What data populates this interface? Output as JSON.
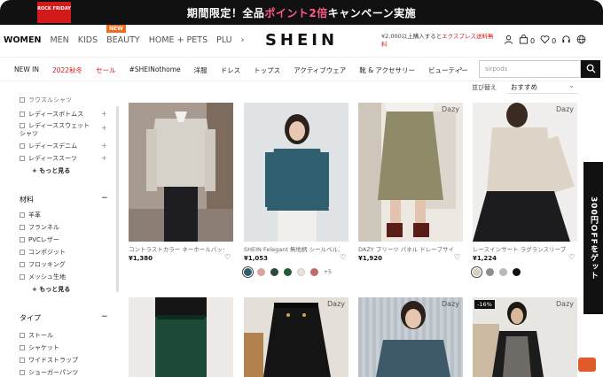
{
  "promo": {
    "logo_text": "ROCK FRIDAY",
    "text_before": "期間限定！全品",
    "text_highlight": "ポイント2倍",
    "text_after": "キャンペーン実施"
  },
  "header": {
    "gender_nav": [
      "WOMEN",
      "MEN",
      "KIDS",
      "BEAUTY",
      "HOME + PETS",
      "PLU",
      "›"
    ],
    "new_badge": "NEW",
    "logo": "SHEIN",
    "ship_note_before": "¥2,000以上購入すると",
    "ship_note_highlight": "エクスプレス送料無料",
    "cart_count": "0",
    "wishlist_count": "0"
  },
  "categories": [
    "NEW IN",
    "2022秋冬",
    "セール",
    "#SHEINothome",
    "洋服",
    "ドレス",
    "トップス",
    "アクティブウェア",
    "靴 & アクセサリー",
    "ビューティー"
  ],
  "search": {
    "placeholder": "sirpods"
  },
  "sort": {
    "label": "並び替え",
    "value": "おすすめ"
  },
  "sidebar": {
    "cut_item": "ラウスルシャツ",
    "group1": [
      "レディースボトムス",
      "レディーススウェットシャツ",
      "レディースデニム",
      "レディーススーツ"
    ],
    "more1": "+ もっと見る",
    "material_title": "材料",
    "materials": [
      "羊革",
      "フランネル",
      "PVCレザー",
      "コンポジット",
      "フロッキング",
      "メッシュ生地"
    ],
    "more2": "+ もっと見る",
    "type_title": "タイプ",
    "types": [
      "ストール",
      "シャケット",
      "ワイドストラップ",
      "ショーガーパンツ"
    ]
  },
  "products": [
    {
      "title": "コントラストカラー ネーホールバック",
      "price": "¥1,380",
      "brand": "",
      "badge": ""
    },
    {
      "title": "SHEIN Felegant 無地柄 シールベルス",
      "price": "¥1,053",
      "brand": "",
      "badge": "",
      "more_colors": "+5"
    },
    {
      "title": "DAZY プリーツ パネル ドレープサイ",
      "price": "¥1,920",
      "brand": "Dazy",
      "badge": ""
    },
    {
      "title": "レースインサート ラグランスリーブ",
      "price": "¥1,224",
      "brand": "Dazy",
      "badge": ""
    },
    {
      "title": "",
      "price": "",
      "brand": "",
      "badge": ""
    },
    {
      "title": "",
      "price": "",
      "brand": "Dazy",
      "badge": ""
    },
    {
      "title": "",
      "price": "",
      "brand": "Dazy",
      "badge": ""
    },
    {
      "title": "",
      "price": "",
      "brand": "Dazy",
      "badge": "-16%"
    }
  ],
  "swatches2": [
    "#2f5f6e",
    "#d9a3a3",
    "#2b4a3a",
    "#245a3c",
    "#e8e2dc",
    "#c06b6b"
  ],
  "swatches4": [
    "#d8cfc3",
    "#8e8e8e",
    "#b8b8b8",
    "#111111"
  ],
  "coupon": {
    "text": "300円OFFをゲット",
    "close": "✕"
  },
  "colors": {
    "accent": "#d21a1a",
    "promo_bg": "#111111",
    "badge": "#f26b1d"
  }
}
